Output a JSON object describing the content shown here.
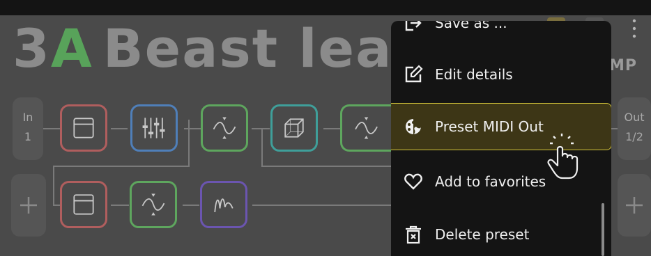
{
  "preset": {
    "number": "3",
    "bank": "A",
    "name": "Beast lead",
    "amp_label": "MP"
  },
  "chain": {
    "input_label": "In",
    "input_value": "1",
    "output_label": "Out",
    "output_value": "1/2",
    "row1_blocks": [
      "amp",
      "eq",
      "filter",
      "cab",
      "filter"
    ],
    "row2_blocks": [
      "amp",
      "filter",
      "wah"
    ],
    "colors": {
      "amp": "#b05e5e",
      "eq": "#4f7fb9",
      "filter": "#5ea65e",
      "cab": "#3f9f9a",
      "wah": "#6b55b0",
      "bank": "#58a35a"
    }
  },
  "menu": {
    "items": [
      {
        "label": "Save as ...",
        "icon": "save-as-icon"
      },
      {
        "label": "Edit details",
        "icon": "edit-icon"
      },
      {
        "label": "Preset MIDI Out",
        "icon": "midi-icon",
        "highlighted": true
      },
      {
        "label": "Add to favorites",
        "icon": "heart-icon"
      },
      {
        "label": "Delete preset",
        "icon": "trash-icon"
      }
    ],
    "highlight_color": "#d6c63a"
  }
}
